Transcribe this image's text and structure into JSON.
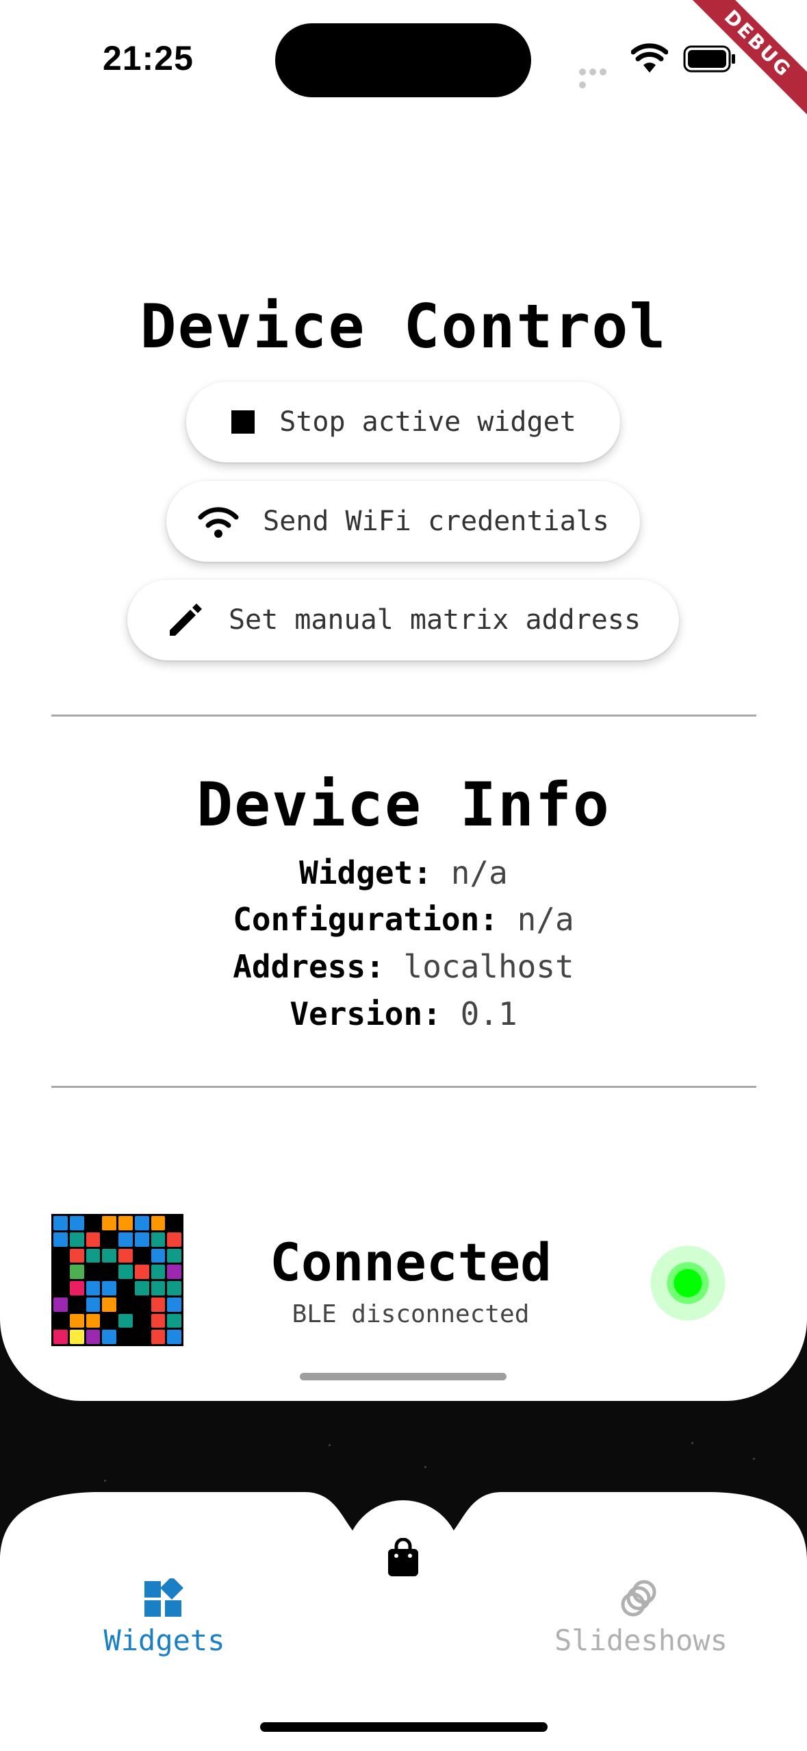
{
  "status_bar": {
    "time": "21:25",
    "debug_label": "DEBUG"
  },
  "device_control": {
    "title": "Device Control",
    "buttons": [
      {
        "label": "Stop active widget",
        "icon": "stop-icon"
      },
      {
        "label": "Send WiFi credentials",
        "icon": "wifi-icon"
      },
      {
        "label": "Set manual matrix address",
        "icon": "pencil-icon"
      }
    ]
  },
  "device_info": {
    "title": "Device Info",
    "rows": [
      {
        "key": "Widget:",
        "value": "n/a"
      },
      {
        "key": "Configuration:",
        "value": "n/a"
      },
      {
        "key": "Address:",
        "value": "localhost"
      },
      {
        "key": "Version:",
        "value": "0.1"
      }
    ]
  },
  "connection": {
    "status": "Connected",
    "ble_status": "BLE disconnected",
    "indicator_color": "#00ff00"
  },
  "matrix_colors": {
    "b": "#1e88e5",
    "t": "#0e9b88",
    "o": "#ff9800",
    "r": "#f44336",
    "g": "#4caf50",
    "p": "#9c27b0",
    "m": "#e91e63",
    "y": "#ffeb3b",
    "k": "#000000"
  },
  "matrix_pattern": [
    "bbkoobok",
    "btrkbbtr",
    "krttrkbt",
    "kgkktrtp",
    "kmbbkttt",
    "pkbokkrb",
    "kooktkrt",
    "mypbkkrb"
  ],
  "nav": {
    "items": [
      {
        "label": "Widgets",
        "icon": "widgets-icon",
        "active": true
      },
      {
        "label": "Slideshows",
        "icon": "slideshows-icon",
        "active": false
      }
    ],
    "center_icon": "shopping-bag-icon",
    "active_color": "#1a7fc4",
    "inactive_color": "#b0b0b0"
  }
}
